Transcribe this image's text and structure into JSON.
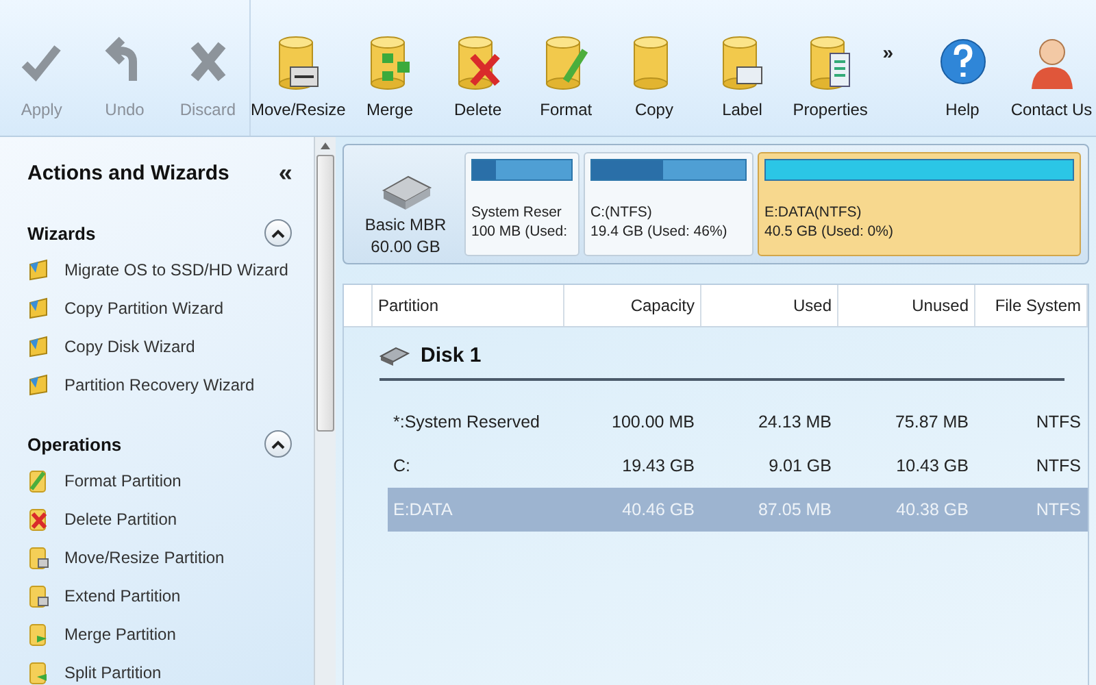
{
  "toolbar": {
    "groups": [
      [
        {
          "kind": "apply",
          "label": "Apply",
          "disabled": true
        },
        {
          "kind": "undo",
          "label": "Undo",
          "disabled": true
        },
        {
          "kind": "discard",
          "label": "Discard",
          "disabled": true
        }
      ],
      [
        {
          "kind": "move",
          "label": "Move/Resize",
          "disabled": false
        },
        {
          "kind": "merge",
          "label": "Merge",
          "disabled": false
        },
        {
          "kind": "delete",
          "label": "Delete",
          "disabled": false
        },
        {
          "kind": "format",
          "label": "Format",
          "disabled": false
        },
        {
          "kind": "copy",
          "label": "Copy",
          "disabled": false
        },
        {
          "kind": "label",
          "label": "Label",
          "disabled": false
        },
        {
          "kind": "properties",
          "label": "Properties",
          "disabled": false
        }
      ],
      [
        {
          "kind": "help",
          "label": "Help",
          "disabled": false
        },
        {
          "kind": "contact",
          "label": "Contact Us",
          "disabled": false
        }
      ]
    ],
    "more": "»"
  },
  "sidebar": {
    "title": "Actions and Wizards",
    "collapse": "«",
    "sections": [
      {
        "title": "Wizards",
        "expanded": true,
        "items": [
          {
            "kind": "wizard",
            "label": "Migrate OS to SSD/HD Wizard"
          },
          {
            "kind": "wizard",
            "label": "Copy Partition Wizard"
          },
          {
            "kind": "wizard",
            "label": "Copy Disk Wizard"
          },
          {
            "kind": "wizard",
            "label": "Partition Recovery Wizard"
          }
        ]
      },
      {
        "title": "Operations",
        "expanded": true,
        "items": [
          {
            "kind": "format",
            "label": "Format Partition"
          },
          {
            "kind": "delete",
            "label": "Delete Partition"
          },
          {
            "kind": "move",
            "label": "Move/Resize Partition"
          },
          {
            "kind": "move",
            "label": "Extend Partition"
          },
          {
            "kind": "merge",
            "label": "Merge Partition"
          },
          {
            "kind": "split",
            "label": "Split Partition"
          }
        ]
      }
    ]
  },
  "disk_map": {
    "disk": {
      "type": "Basic MBR",
      "size": "60.00 GB"
    },
    "partitions": [
      {
        "name": "System Reser",
        "detail": "100 MB (Used:",
        "level": 0.24,
        "selected": false
      },
      {
        "name": "C:(NTFS)",
        "detail": "19.4 GB (Used: 46%)",
        "level": 0.46,
        "selected": false
      },
      {
        "name": "E:DATA(NTFS)",
        "detail": "40.5 GB (Used: 0%)",
        "level": 0,
        "selected": true
      }
    ]
  },
  "table": {
    "columns": [
      "Partition",
      "Capacity",
      "Used",
      "Unused",
      "File System"
    ],
    "disk": "Disk 1",
    "rows": [
      {
        "cells": [
          "*:System Reserved",
          "100.00 MB",
          "24.13 MB",
          "75.87 MB",
          "NTFS"
        ],
        "selected": false
      },
      {
        "cells": [
          "C:",
          "19.43 GB",
          "9.01 GB",
          "10.43 GB",
          "NTFS"
        ],
        "selected": false
      },
      {
        "cells": [
          "E:DATA",
          "40.46 GB",
          "87.05 MB",
          "40.38 GB",
          "NTFS"
        ],
        "selected": true
      }
    ]
  }
}
